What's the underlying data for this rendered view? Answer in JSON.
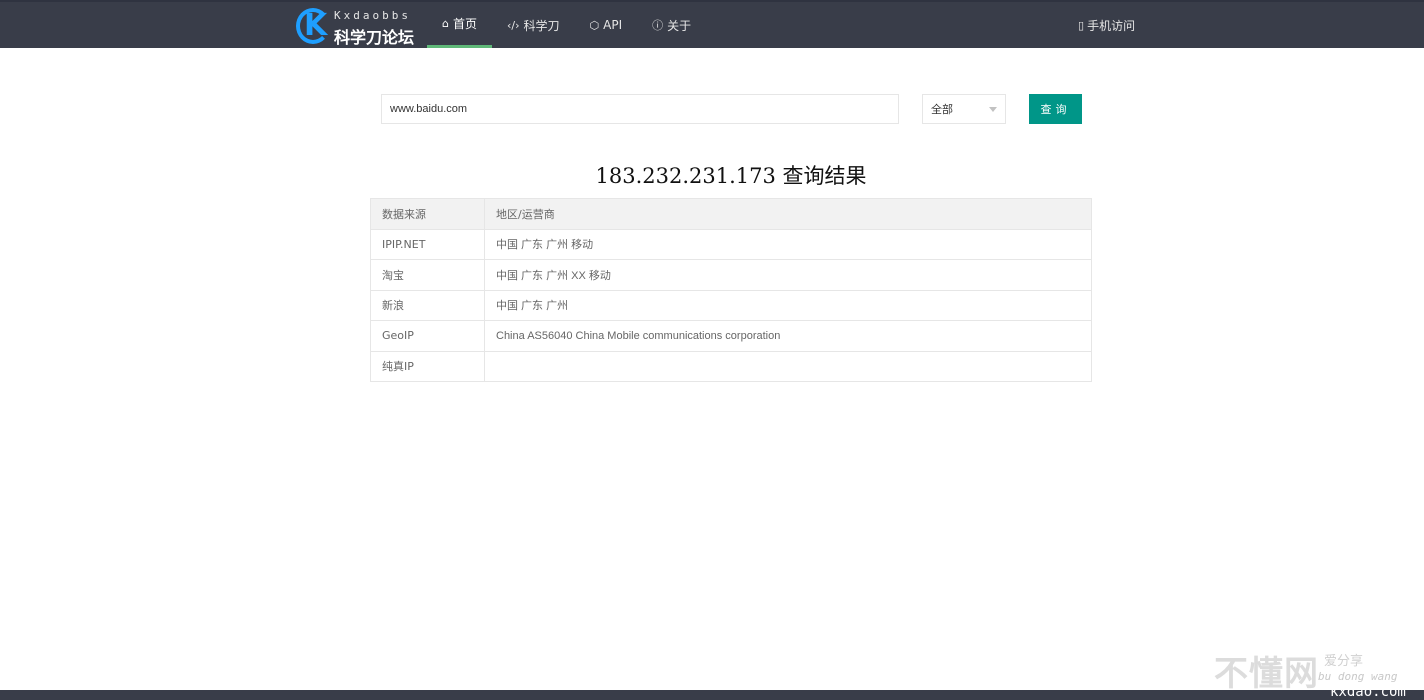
{
  "header": {
    "logo_sub": "Kxdaobbs",
    "logo_title": "科学刀论坛",
    "logo_letter": "K",
    "nav": [
      {
        "label": "首页",
        "icon": "home-icon",
        "glyph": "⌂",
        "active": true
      },
      {
        "label": "科学刀",
        "icon": "code-icon",
        "glyph": "‹/›",
        "active": false
      },
      {
        "label": "API",
        "icon": "cube-icon",
        "glyph": "⬡",
        "active": false
      },
      {
        "label": "关于",
        "icon": "info-circle-icon",
        "glyph": "ⓘ",
        "active": false
      }
    ],
    "mobile_label": "手机访问",
    "mobile_icon": "tablet-icon",
    "mobile_glyph": "▯"
  },
  "search": {
    "value": "www.baidu.com",
    "select_value": "全部",
    "button_label": "查询"
  },
  "result": {
    "title": "183.232.231.173 查询结果",
    "columns": [
      "数据来源",
      "地区/运营商"
    ],
    "rows": [
      {
        "source": "IPIP.NET",
        "region": "中国 广东 广州 移动"
      },
      {
        "source": "淘宝",
        "region": "中国 广东 广州 XX 移动"
      },
      {
        "source": "新浪",
        "region": "中国 广东 广州"
      },
      {
        "source": "GeoIP",
        "region": "China AS56040 China Mobile communications corporation"
      },
      {
        "source": "纯真IP",
        "region": ""
      }
    ]
  },
  "watermark": {
    "main": "不懂网",
    "share": "爱分享",
    "pinyin": "bu dong wang",
    "site": "kxdao.com"
  },
  "colors": {
    "topbar": "#393d49",
    "active_underline": "#5fb878",
    "button": "#009688",
    "logo_blue": "#1e9fff"
  }
}
